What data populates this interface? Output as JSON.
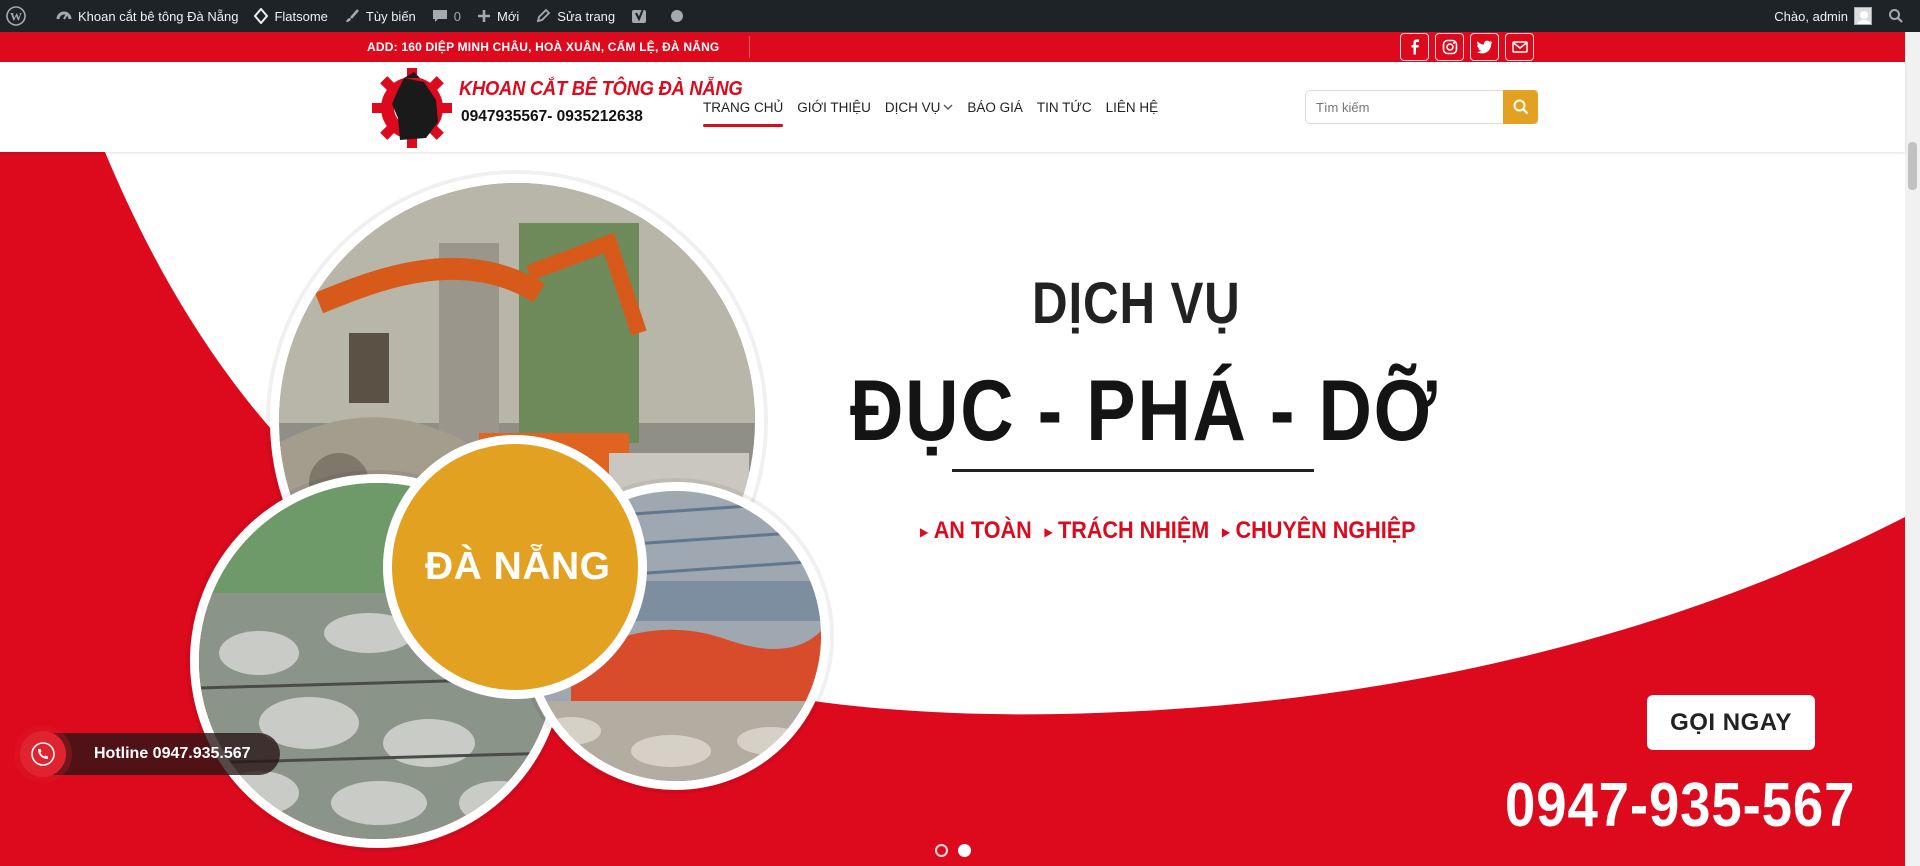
{
  "adminbar": {
    "site_name": "Khoan cắt bê tông Đà Nẵng",
    "theme": "Flatsome",
    "customize": "Tùy biến",
    "comments_count": "0",
    "new": "Mới",
    "edit_page": "Sửa trang",
    "greeting": "Chào, admin"
  },
  "topbar": {
    "address": "ADD: 160 DIỆP MINH CHÂU, HOÀ XUÂN, CẨM LỆ, ĐÀ NẴNG",
    "socials": [
      "facebook-icon",
      "instagram-icon",
      "twitter-icon",
      "email-icon"
    ]
  },
  "header": {
    "logo_name": "KHOAN CẮT BÊ TÔNG ĐÀ NẴNG",
    "logo_phone": "0947935567- 0935212638",
    "nav": [
      "TRANG CHỦ",
      "GIỚI THIỆU",
      "DỊCH VỤ",
      "BÁO GIÁ",
      "TIN TỨC",
      "LIÊN HỆ"
    ],
    "active_nav": "TRANG CHỦ",
    "search_placeholder": "Tìm kiếm"
  },
  "hero": {
    "circle_label": "ĐÀ NẴNG",
    "heading_small": "DỊCH VỤ",
    "heading_big": "ĐỤC - PHÁ - DỠ",
    "tags": [
      "AN TOÀN",
      "TRÁCH NHIỆM",
      "CHUYÊN NGHIỆP"
    ],
    "cta": "GỌI NGAY",
    "phone": "0947-935-567",
    "slides_total": 2,
    "active_slide": 2
  },
  "hotline": {
    "label": "Hotline 0947.935.567"
  },
  "colors": {
    "brand_red": "#dd0a1e",
    "accent_gold": "#e3a121",
    "admin_bar": "#1d2327"
  }
}
